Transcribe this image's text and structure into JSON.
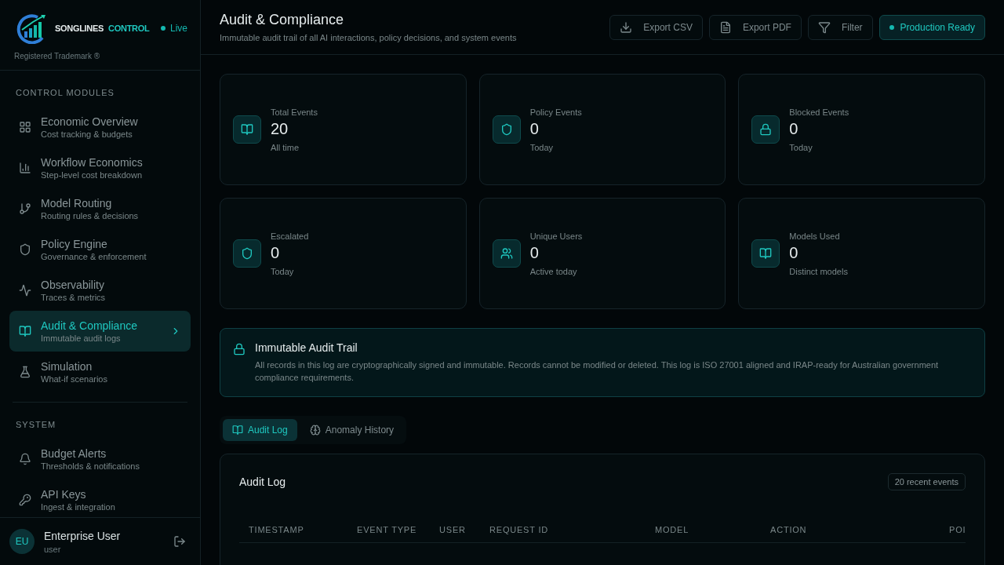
{
  "brand": {
    "name_part1": "SONGLINES",
    "name_part2": "CONTROL",
    "status": "Live",
    "trademark": "Registered Trademark ®"
  },
  "sidebar": {
    "sections": [
      {
        "title": "CONTROL MODULES",
        "items": [
          {
            "label": "Economic Overview",
            "sub": "Cost tracking & budgets",
            "selected": false
          },
          {
            "label": "Workflow Economics",
            "sub": "Step-level cost breakdown",
            "selected": false
          },
          {
            "label": "Model Routing",
            "sub": "Routing rules & decisions",
            "selected": false
          },
          {
            "label": "Policy Engine",
            "sub": "Governance & enforcement",
            "selected": false
          },
          {
            "label": "Observability",
            "sub": "Traces & metrics",
            "selected": false
          },
          {
            "label": "Audit & Compliance",
            "sub": "Immutable audit logs",
            "selected": true
          },
          {
            "label": "Simulation",
            "sub": "What-if scenarios",
            "selected": false
          }
        ]
      },
      {
        "title": "SYSTEM",
        "items": [
          {
            "label": "Budget Alerts",
            "sub": "Thresholds & notifications",
            "selected": false
          },
          {
            "label": "API Keys",
            "sub": "Ingest & integration",
            "selected": false
          }
        ]
      }
    ],
    "user": {
      "initials": "EU",
      "name": "Enterprise User",
      "role": "user"
    }
  },
  "header": {
    "title": "Audit & Compliance",
    "subtitle": "Immutable audit trail of all AI interactions, policy decisions, and system events",
    "actions": [
      {
        "label": "Export CSV"
      },
      {
        "label": "Export PDF"
      },
      {
        "label": "Filter"
      }
    ],
    "status": "Production Ready"
  },
  "stats": [
    {
      "label": "Total Events",
      "value": "20",
      "sub": "All time"
    },
    {
      "label": "Policy Events",
      "value": "0",
      "sub": "Today"
    },
    {
      "label": "Blocked Events",
      "value": "0",
      "sub": "Today"
    },
    {
      "label": "Escalated",
      "value": "0",
      "sub": "Today"
    },
    {
      "label": "Unique Users",
      "value": "0",
      "sub": "Active today"
    },
    {
      "label": "Models Used",
      "value": "0",
      "sub": "Distinct models"
    }
  ],
  "notice": {
    "title": "Immutable Audit Trail",
    "text": "All records in this log are cryptographically signed and immutable. Records cannot be modified or deleted. This log is ISO 27001 aligned and IRAP-ready for Australian government compliance requirements."
  },
  "tabs": [
    {
      "label": "Audit Log",
      "selected": true
    },
    {
      "label": "Anomaly History",
      "selected": false
    }
  ],
  "table": {
    "title": "Audit Log",
    "count": "20 recent events",
    "columns": [
      "TIMESTAMP",
      "EVENT TYPE",
      "USER",
      "REQUEST ID",
      "MODEL",
      "ACTION",
      "POI"
    ]
  }
}
